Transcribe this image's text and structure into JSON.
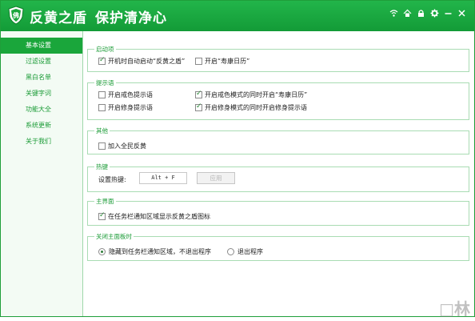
{
  "app": {
    "title": "反黄之盾",
    "subtitle": "保护清净心",
    "accent_color": "#1aa63b"
  },
  "window_controls": [
    "wifi-icon",
    "home-icon",
    "lock-icon",
    "gear-icon",
    "minimize-icon",
    "close-icon"
  ],
  "sidebar": {
    "items": [
      {
        "label": "基本设置",
        "active": true
      },
      {
        "label": "过滤设置",
        "active": false
      },
      {
        "label": "黑白名单",
        "active": false
      },
      {
        "label": "关键字词",
        "active": false
      },
      {
        "label": "功能大全",
        "active": false
      },
      {
        "label": "系统更新",
        "active": false
      },
      {
        "label": "关于我们",
        "active": false
      }
    ]
  },
  "groups": {
    "startup": {
      "title": "启动项",
      "options": [
        {
          "label": "开机时自动启动“反黄之盾”",
          "checked": true
        },
        {
          "label": "开启“寿康日历”",
          "checked": false
        }
      ]
    },
    "prompts": {
      "title": "提示语",
      "options": [
        {
          "label": "开启戒色提示语",
          "checked": false
        },
        {
          "label": "开启戒色模式的同时开启“寿康日历”",
          "checked": true
        },
        {
          "label": "开启修身提示语",
          "checked": false
        },
        {
          "label": "开启修身模式的同时开启修身提示语",
          "checked": true
        }
      ]
    },
    "other": {
      "title": "其他",
      "options": [
        {
          "label": "加入全民反黄",
          "checked": false
        }
      ]
    },
    "hotkey": {
      "title": "热键",
      "label": "设置热键:",
      "value": "Alt + F",
      "apply_label": "应用"
    },
    "main_ui": {
      "title": "主界面",
      "options": [
        {
          "label": "在任务栏通知区域显示反黄之盾图标",
          "checked": true
        }
      ]
    },
    "close_main": {
      "title": "关闭主面板时",
      "options": [
        {
          "label": "隐藏到任务栏通知区域，不退出程序",
          "checked": true
        },
        {
          "label": "退出程序",
          "checked": false
        }
      ]
    }
  },
  "watermark": "□林"
}
